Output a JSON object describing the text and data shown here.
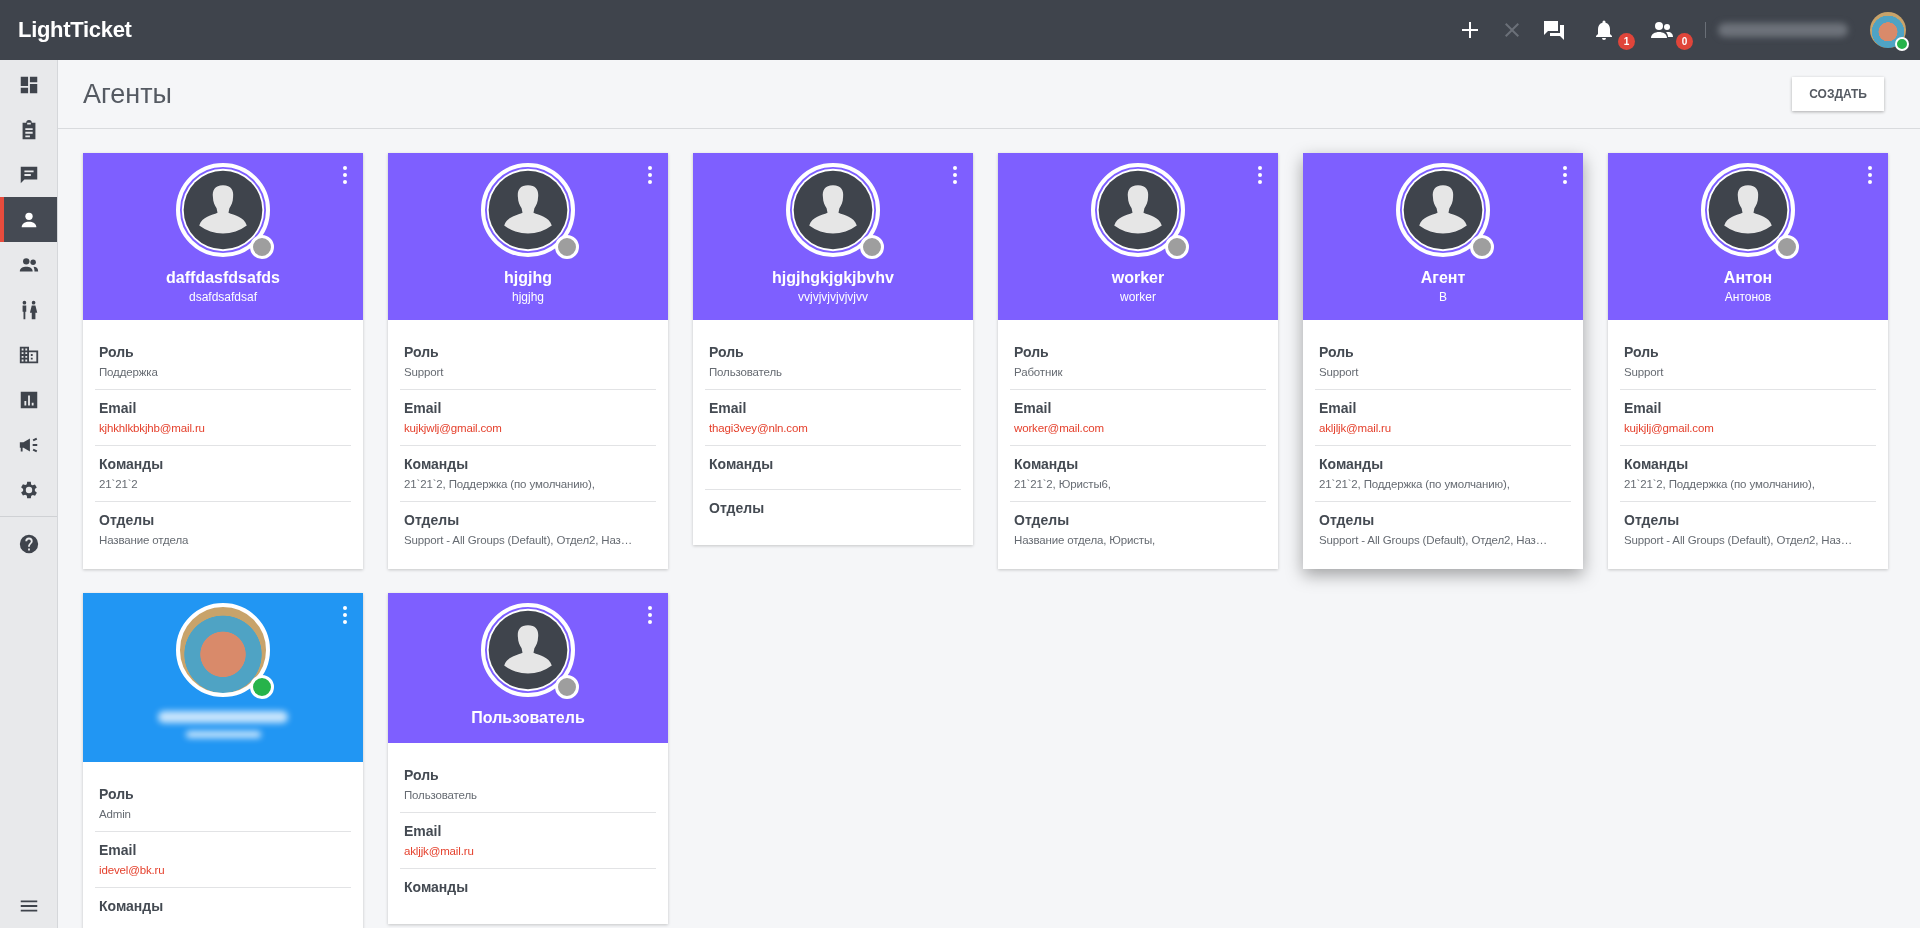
{
  "topbar": {
    "logo": "LightTicket",
    "badges": [
      {
        "count": "1"
      },
      {
        "count": "0"
      }
    ],
    "user": {
      "name_blurred": true,
      "online": true
    }
  },
  "sidebar": {
    "items": [
      {
        "selected": false
      },
      {
        "selected": false
      },
      {
        "selected": false
      },
      {
        "selected": true
      },
      {
        "selected": false
      },
      {
        "selected": false
      },
      {
        "selected": false
      },
      {
        "selected": false
      },
      {
        "selected": false
      },
      {
        "selected": false
      },
      {
        "selected": false
      }
    ]
  },
  "page": {
    "title": "Агенты",
    "create_button": "СОЗДАТЬ"
  },
  "cards": [
    {
      "name": "daffdasfdsafds",
      "subtitle": "dsafdsafdsaf",
      "color": "#7e5fff",
      "kind": "silhouette",
      "online": false,
      "hovered": false,
      "fields": [
        {
          "label": "Роль",
          "value": "Поддержка",
          "kind": "text"
        },
        {
          "label": "Email",
          "value": "kjhkhlkbkjhb@mail.ru",
          "kind": "email"
        },
        {
          "label": "Команды",
          "value": "21`21`2",
          "kind": "text"
        },
        {
          "label": "Отделы",
          "value": "Название отдела",
          "kind": "text"
        }
      ]
    },
    {
      "name": "hjgjhg",
      "subtitle": "hjgjhg",
      "color": "#7e5fff",
      "kind": "silhouette",
      "online": false,
      "hovered": false,
      "fields": [
        {
          "label": "Роль",
          "value": "Support",
          "kind": "text"
        },
        {
          "label": "Email",
          "value": "kujkjwlj@gmail.com",
          "kind": "email"
        },
        {
          "label": "Команды",
          "value": "21`21`2, Поддержка (по умолчанию),",
          "kind": "text"
        },
        {
          "label": "Отделы",
          "value": "Support - All Groups (Default), Отдел2, Наз…",
          "kind": "text"
        }
      ]
    },
    {
      "name": "hjgjhgkjgkjbvhv",
      "subtitle": "vvjvjvjvjvjvjvv",
      "color": "#7e5fff",
      "kind": "silhouette",
      "online": false,
      "hovered": false,
      "fields": [
        {
          "label": "Роль",
          "value": "Пользователь",
          "kind": "text"
        },
        {
          "label": "Email",
          "value": "thagi3vey@nln.com",
          "kind": "email"
        },
        {
          "label": "Команды"
        },
        {
          "label": "Отделы"
        }
      ]
    },
    {
      "name": "worker",
      "subtitle": "worker",
      "color": "#7e5fff",
      "kind": "silhouette",
      "online": false,
      "hovered": false,
      "fields": [
        {
          "label": "Роль",
          "value": "Работник",
          "kind": "text"
        },
        {
          "label": "Email",
          "value": "worker@mail.com",
          "kind": "email"
        },
        {
          "label": "Команды",
          "value": "21`21`2, Юристы6,",
          "kind": "text"
        },
        {
          "label": "Отделы",
          "value": "Название отдела, Юристы,",
          "kind": "text"
        }
      ]
    },
    {
      "name": "Агент",
      "subtitle": "В",
      "color": "#7e5fff",
      "kind": "silhouette",
      "online": false,
      "hovered": true,
      "fields": [
        {
          "label": "Роль",
          "value": "Support",
          "kind": "text"
        },
        {
          "label": "Email",
          "value": "akljljk@mail.ru",
          "kind": "email"
        },
        {
          "label": "Команды",
          "value": "21`21`2, Поддержка (по умолчанию),",
          "kind": "text"
        },
        {
          "label": "Отделы",
          "value": "Support - All Groups (Default), Отдел2, Наз…",
          "kind": "text"
        }
      ]
    },
    {
      "name": "Антон",
      "subtitle": "Антонов",
      "color": "#7e5fff",
      "kind": "silhouette",
      "online": false,
      "hovered": false,
      "fields": [
        {
          "label": "Роль",
          "value": "Support",
          "kind": "text"
        },
        {
          "label": "Email",
          "value": "kujkjlj@gmail.com",
          "kind": "email"
        },
        {
          "label": "Команды",
          "value": "21`21`2, Поддержка (по умолчанию),",
          "kind": "text"
        },
        {
          "label": "Отделы",
          "value": "Support - All Groups (Default), Отдел2, Наз…",
          "kind": "text"
        }
      ]
    },
    {
      "name_blurred": true,
      "color": "#2196f3",
      "kind": "photo",
      "online": true,
      "hovered": false,
      "fields": [
        {
          "label": "Роль",
          "value": "Admin",
          "kind": "text"
        },
        {
          "label": "Email",
          "value": "idevel@bk.ru",
          "kind": "email"
        },
        {
          "label": "Команды"
        }
      ]
    },
    {
      "name": "Пользователь",
      "color": "#7e5fff",
      "kind": "silhouette",
      "online": false,
      "hovered": false,
      "fields": [
        {
          "label": "Роль",
          "value": "Пользователь",
          "kind": "text"
        },
        {
          "label": "Email",
          "value": "akljjk@mail.ru",
          "kind": "email"
        },
        {
          "label": "Команды"
        }
      ]
    }
  ]
}
